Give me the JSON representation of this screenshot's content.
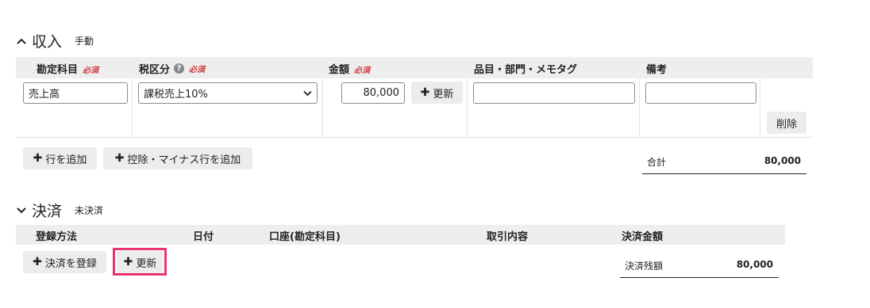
{
  "income": {
    "title": "収入",
    "mode": "手動",
    "headers": {
      "account": "勘定科目",
      "tax": "税区分",
      "amount": "金額",
      "item": "品目・部門・メモタグ",
      "note": "備考",
      "required": "必須",
      "help": "?"
    },
    "row": {
      "account": "売上高",
      "tax": "課税売上10%",
      "amount": "80,000",
      "update_label": "更新",
      "item": "",
      "note": "",
      "delete_label": "削除"
    },
    "add_row_label": "行を追加",
    "add_deduction_row_label": "控除・マイナス行を追加",
    "total_label": "合計",
    "total_value": "80,000"
  },
  "settlement": {
    "title": "決済",
    "status": "未決済",
    "headers": {
      "method": "登録方法",
      "date": "日付",
      "account": "口座(勘定科目)",
      "description": "取引内容",
      "amount": "決済金額"
    },
    "register_label": "決済を登録",
    "update_label": "更新",
    "balance_label": "決済残額",
    "balance_value": "80,000"
  },
  "colors": {
    "required": "#d23a3a",
    "highlight": "#e8336d",
    "header_bg": "#eeeeee"
  }
}
